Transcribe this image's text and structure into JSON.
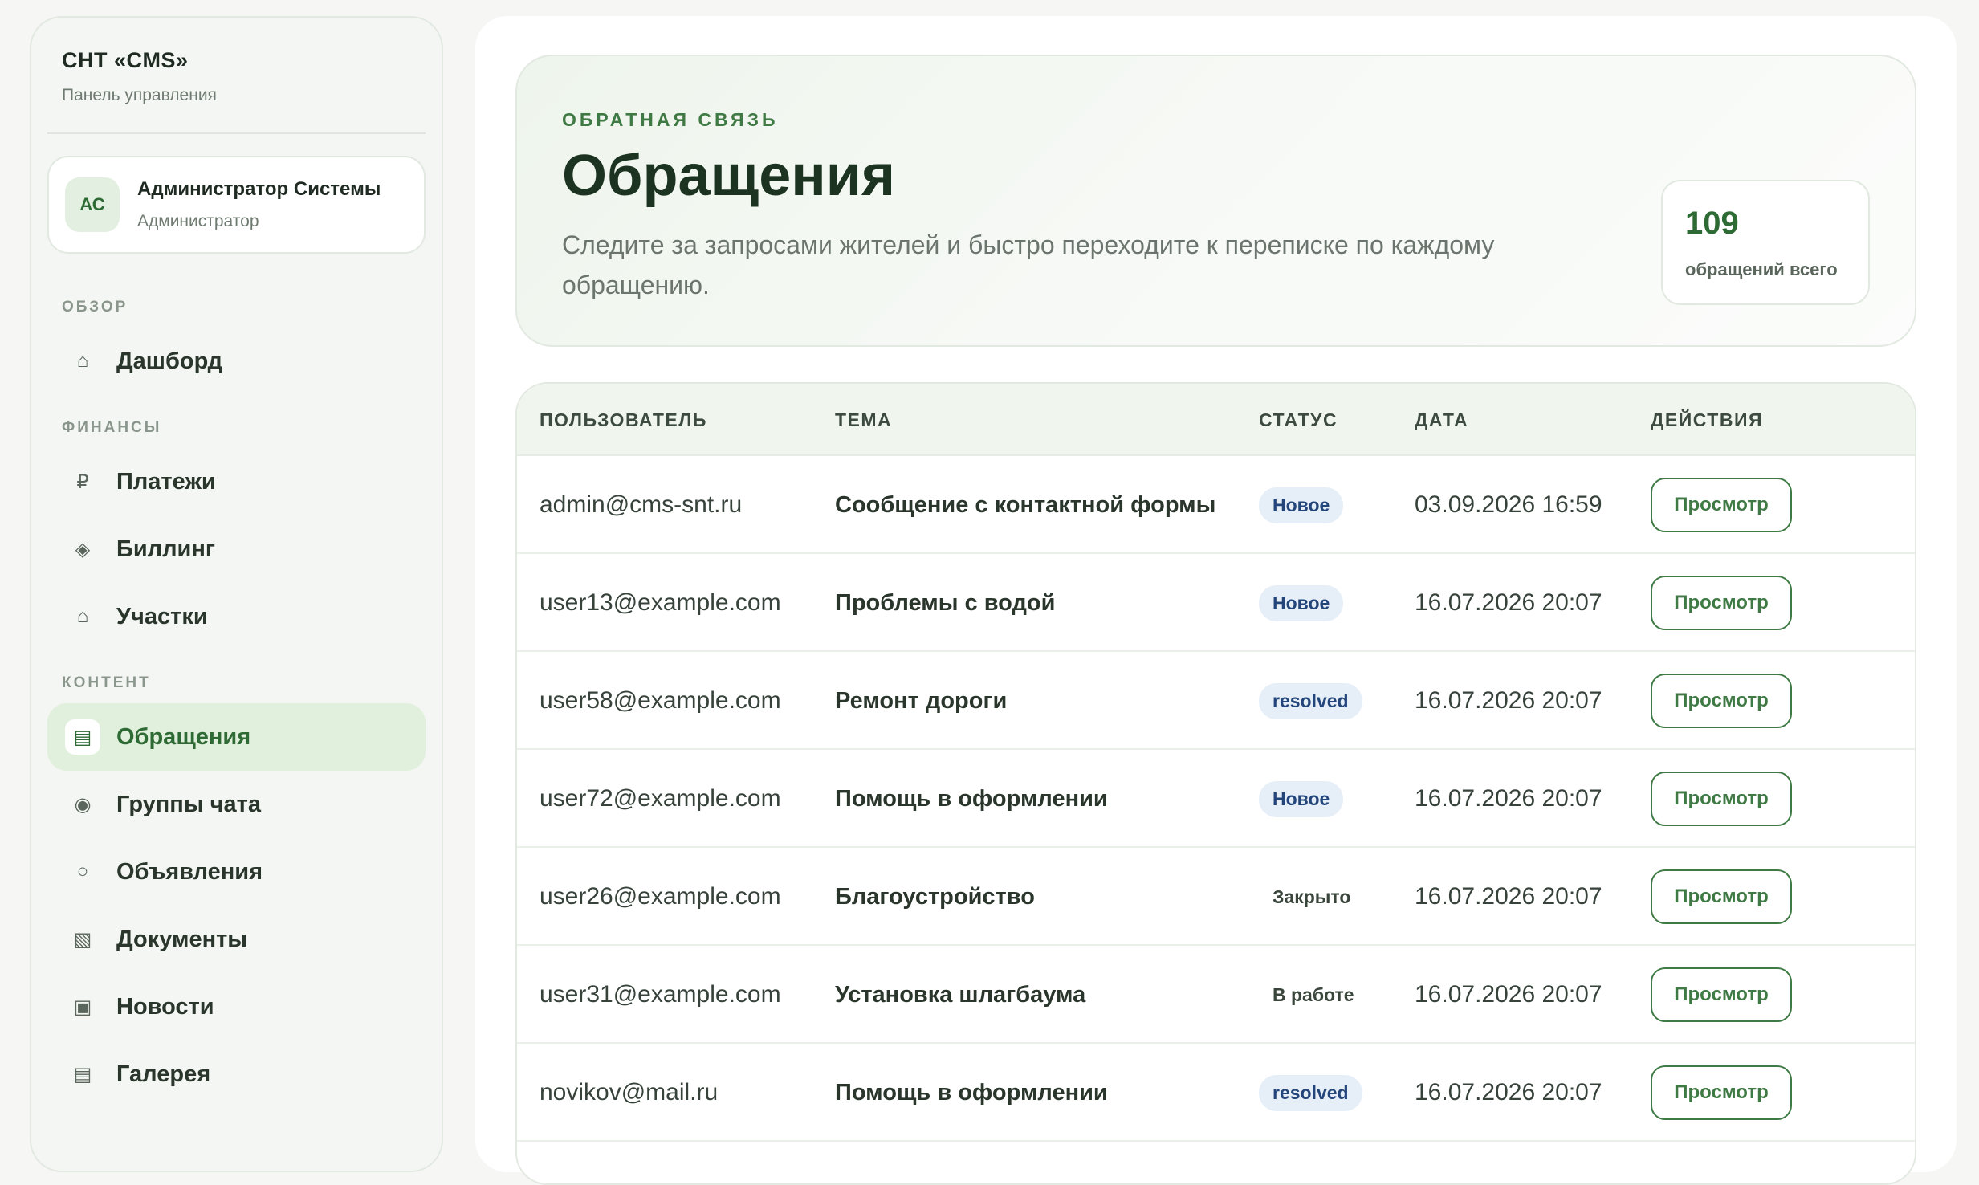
{
  "sidebar": {
    "brand_title": "СНТ «CMS»",
    "brand_subtitle": "Панель управления",
    "user": {
      "initials": "АС",
      "name": "Администратор Системы",
      "role": "Администратор"
    },
    "sections": [
      {
        "title": "Обзор",
        "items": [
          {
            "icon": "⌂",
            "label": "Дашборд"
          }
        ]
      },
      {
        "title": "Финансы",
        "items": [
          {
            "icon": "₽",
            "label": "Платежи"
          },
          {
            "icon": "◈",
            "label": "Биллинг"
          },
          {
            "icon": "⌂",
            "label": "Участки"
          }
        ]
      },
      {
        "title": "Контент",
        "items": [
          {
            "icon": "▤",
            "label": "Обращения",
            "active": true
          },
          {
            "icon": "◉",
            "label": "Группы чата"
          },
          {
            "icon": "○",
            "label": "Объявления"
          },
          {
            "icon": "▧",
            "label": "Документы"
          },
          {
            "icon": "▣",
            "label": "Новости"
          },
          {
            "icon": "▤",
            "label": "Галерея"
          }
        ]
      }
    ]
  },
  "hero": {
    "eyebrow": "Обратная связь",
    "title": "Обращения",
    "description": "Следите за запросами жителей и быстро переходите к переписке по каждому обращению.",
    "stat_value": "109",
    "stat_label": "обращений всего"
  },
  "table": {
    "columns": [
      "Пользователь",
      "Тема",
      "Статус",
      "Дата",
      "Действия"
    ],
    "action_label": "Просмотр",
    "rows": [
      {
        "user": "admin@cms-snt.ru",
        "topic": "Сообщение с контактной формы",
        "status": "Новое",
        "status_kind": "new",
        "date": "03.09.2026 16:59"
      },
      {
        "user": "user13@example.com",
        "topic": "Проблемы с водой",
        "status": "Новое",
        "status_kind": "new",
        "date": "16.07.2026 20:07"
      },
      {
        "user": "user58@example.com",
        "topic": "Ремонт дороги",
        "status": "resolved",
        "status_kind": "resolved",
        "date": "16.07.2026 20:07"
      },
      {
        "user": "user72@example.com",
        "topic": "Помощь в оформлении",
        "status": "Новое",
        "status_kind": "new",
        "date": "16.07.2026 20:07"
      },
      {
        "user": "user26@example.com",
        "topic": "Благоустройство",
        "status": "Закрыто",
        "status_kind": "plain",
        "date": "16.07.2026 20:07"
      },
      {
        "user": "user31@example.com",
        "topic": "Установка шлагбаума",
        "status": "В работе",
        "status_kind": "plain",
        "date": "16.07.2026 20:07"
      },
      {
        "user": "novikov@mail.ru",
        "topic": "Помощь в оформлении",
        "status": "resolved",
        "status_kind": "resolved",
        "date": "16.07.2026 20:07"
      }
    ]
  },
  "colors": {
    "accent": "#3f7a44",
    "accent_soft": "#e1efdd",
    "badge_blue_bg": "#e6eef8",
    "badge_blue_text": "#23457a"
  }
}
